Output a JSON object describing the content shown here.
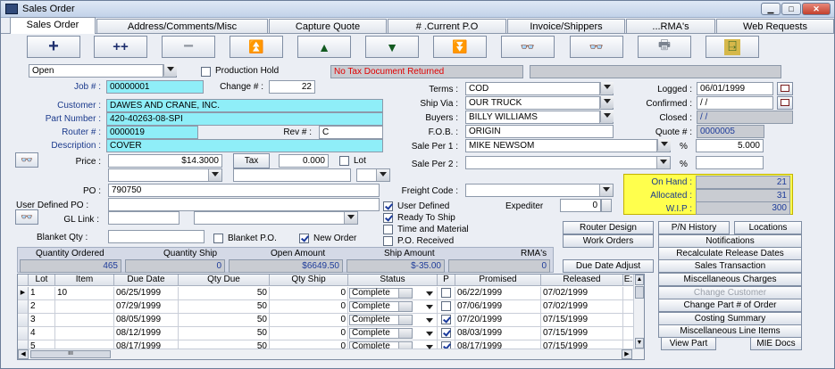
{
  "window": {
    "title": "Sales Order",
    "minimize": "▁",
    "maximize": "□",
    "close": "✕"
  },
  "tabs": [
    {
      "label": "Sales Order"
    },
    {
      "label": "Address/Comments/Misc"
    },
    {
      "label": "Capture Quote"
    },
    {
      "label": "# .Current P.O"
    },
    {
      "label": "Invoice/Shippers"
    },
    {
      "label": "...RMA's"
    },
    {
      "label": "Web Requests"
    }
  ],
  "toolbar": [
    {
      "icon": "add-icon",
      "symbol": "+"
    },
    {
      "icon": "add-multiple-icon",
      "symbol": "++"
    },
    {
      "icon": "remove-icon",
      "symbol": "−"
    },
    {
      "icon": "first-record-icon",
      "symbol": "⏫"
    },
    {
      "icon": "previous-record-icon",
      "symbol": "▲"
    },
    {
      "icon": "next-record-icon",
      "symbol": "▼"
    },
    {
      "icon": "last-record-icon",
      "symbol": "⏬"
    },
    {
      "icon": "binoculars-icon",
      "symbol": "👓"
    },
    {
      "icon": "binoculars-alt-icon",
      "symbol": "👓"
    },
    {
      "icon": "print-icon",
      "symbol": "🖶"
    },
    {
      "icon": "exit-door-icon",
      "symbol": "⍈"
    }
  ],
  "form": {
    "status": "Open",
    "production_hold": "Production Hold",
    "tax_notice": "No Tax Document Returned",
    "job_label": "Job # :",
    "job": "00000001",
    "change_label": "Change # :",
    "change": "22",
    "customer_label": "Customer :",
    "customer": "DAWES AND CRANE, INC.",
    "part_label": "Part Number :",
    "part": "420-40263-08-SPI",
    "router_label": "Router # :",
    "router": "0000019",
    "rev_label": "Rev # :",
    "rev": "C",
    "desc_label": "Description :",
    "desc": "COVER",
    "price_label": "Price :",
    "price": "$14.3000",
    "tax_btn": "Tax",
    "tax": "0.000",
    "lot_label": "Lot",
    "po_label": "PO :",
    "po": "790750",
    "udpo_label": "User Defined PO :",
    "gl_label": "GL Link :",
    "blanket_label": "Blanket Qty :",
    "blanket_po": "Blanket P.O.",
    "new_order": "New Order",
    "terms_label": "Terms :",
    "terms": "COD",
    "shipvia_label": "Ship Via :",
    "shipvia": "OUR TRUCK",
    "buyers_label": "Buyers :",
    "buyers": "BILLY WILLIAMS",
    "fob_label": "F.O.B. :",
    "fob": "ORIGIN",
    "saleper1_label": "Sale Per 1 :",
    "saleper1": "MIKE NEWSOM",
    "pct1": "%",
    "pct1_val": "5.000",
    "saleper2_label": "Sale Per 2 :",
    "pct2": "%",
    "freight_label": "Freight Code :",
    "expediter_label": "Expediter",
    "expediter": "0",
    "user_defined": "User Defined",
    "ready_to_ship": "Ready To Ship",
    "time_material": "Time and Material",
    "po_received": "P.O. Received",
    "logged_label": "Logged :",
    "logged": "06/01/1999",
    "confirmed_label": "Confirmed :",
    "confirmed": " / /",
    "closed_label": "Closed :",
    "closed": " / /",
    "quote_label": "Quote # :",
    "quote": "0000005"
  },
  "stock": {
    "on_hand_label": "On Hand :",
    "on_hand": "21",
    "allocated_label": "Allocated :",
    "allocated": "31",
    "wip_label": "W.I.P :",
    "wip": "300"
  },
  "summary": {
    "qty_ordered_label": "Quantity Ordered",
    "qty_ordered": "465",
    "qty_ship_label": "Quantity Ship",
    "qty_ship": "0",
    "open_amount_label": "Open Amount",
    "open_amount": "$6649.50",
    "ship_amount_label": "Ship Amount",
    "ship_amount": "$-35.00",
    "rma_label": "RMA's",
    "rma": "0"
  },
  "side_buttons": {
    "router_design": "Router Design",
    "pn_history": "P/N History",
    "locations": "Locations",
    "work_orders": "Work Orders",
    "notifications": "Notifications",
    "recalc": "Recalculate Release Dates",
    "due_adjust": "Due Date Adjust",
    "sales_tx": "Sales Transaction",
    "misc_charges": "Miscellaneous Charges",
    "change_customer": "Change Customer",
    "change_part": "Change Part # of Order",
    "costing": "Costing Summary",
    "misc_lines": "Miscellaneous Line Items",
    "view_part": "View Part",
    "mie_docs": "MIE Docs"
  },
  "grid": {
    "columns": [
      "Lot",
      "Item",
      "Due Date",
      "Qty Due",
      "Qty Ship",
      "Status",
      "P",
      "Promised",
      "Released",
      "E:"
    ],
    "rows": [
      {
        "lot": "1",
        "item": "10",
        "due": "06/25/1999",
        "qty_due": "50",
        "qty_ship": "0",
        "status": "Complete",
        "p": false,
        "promised": "06/22/1999",
        "released": "07/02/1999"
      },
      {
        "lot": "2",
        "item": "",
        "due": "07/29/1999",
        "qty_due": "50",
        "qty_ship": "0",
        "status": "Complete",
        "p": false,
        "promised": "07/06/1999",
        "released": "07/02/1999"
      },
      {
        "lot": "3",
        "item": "",
        "due": "08/05/1999",
        "qty_due": "50",
        "qty_ship": "0",
        "status": "Complete",
        "p": true,
        "promised": "07/20/1999",
        "released": "07/15/1999"
      },
      {
        "lot": "4",
        "item": "",
        "due": "08/12/1999",
        "qty_due": "50",
        "qty_ship": "0",
        "status": "Complete",
        "p": true,
        "promised": "08/03/1999",
        "released": "07/15/1999"
      },
      {
        "lot": "5",
        "item": "",
        "due": "08/17/1999",
        "qty_due": "50",
        "qty_ship": "0",
        "status": "Complete",
        "p": true,
        "promised": "08/17/1999",
        "released": "07/15/1999"
      }
    ]
  },
  "colors": {
    "cyan": "#8feef8",
    "stock_bg": "#ffff4d",
    "label_blue": "#1b3a8c",
    "tax_red": "#e00000"
  }
}
